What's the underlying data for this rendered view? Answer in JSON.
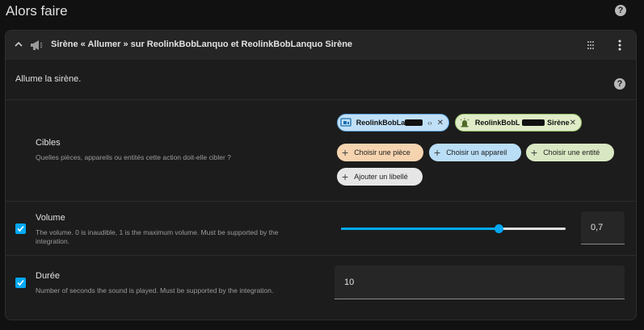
{
  "page": {
    "title": "Alors faire",
    "help": "?"
  },
  "action": {
    "title": "Sirène « Allumer » sur ReolinkBobLanquo et ReolinkBobLanquo Sirène",
    "description": "Allume la sirène.",
    "help": "?"
  },
  "targets": {
    "label": "Cibles",
    "description": "Quelles pièces, appareils ou entités cette action doit-elle cibler ?",
    "chips": [
      {
        "label": "ReolinkBobLa",
        "code": "‹›",
        "icon": "device-icon",
        "color": "#c0e0f8"
      },
      {
        "label": "ReolinkBobL",
        "suffix": "Sirène",
        "icon": "siren-icon",
        "color": "#dfecc7"
      }
    ],
    "buttons": [
      {
        "label": "Choisir une pièce",
        "color": "#f7d4b0"
      },
      {
        "label": "Choisir un appareil",
        "color": "#b9def6"
      },
      {
        "label": "Choisir une entité",
        "color": "#d9e8c3"
      },
      {
        "label": "Ajouter un libellé",
        "color": "#e6e6e6"
      }
    ],
    "remove": "✕",
    "add": "+"
  },
  "volume": {
    "label": "Volume",
    "description": "The volume. 0 is inaudible, 1 is the maximum volume. Must be supported by the integration.",
    "value": "0,7",
    "level": 0.7,
    "checked": true
  },
  "duration": {
    "label": "Durée",
    "description": "Number of seconds the sound is played. Must be supported by the integration.",
    "value": "10",
    "checked": true
  },
  "colors": {
    "accent": "#03a9f4",
    "background": "#111111",
    "card": "#1c1c1c"
  }
}
